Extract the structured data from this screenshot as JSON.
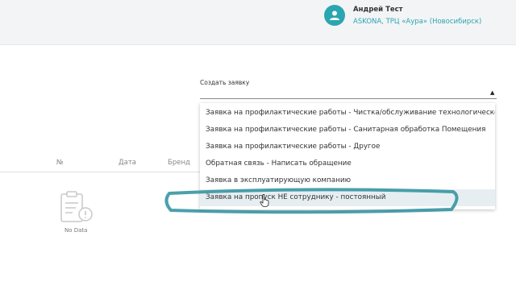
{
  "header": {
    "user_name": "Андрей Тест",
    "user_store": "ASKONA, ТРЦ «Аура» (Новосибирск)",
    "accent_color": "#2aa6b0"
  },
  "create_request": {
    "label": "Создать заявку",
    "options": [
      "Заявка на профилактические работы - Чистка/обслуживание технологического оборудования",
      "Заявка на профилактические работы - Санитарная обработка Помещения",
      "Заявка на профилактические работы - Другое",
      "Обратная связь - Написать обращение",
      "Заявка в эксплуатирующую компанию",
      "Заявка на пропуск НЕ сотруднику - постоянный"
    ],
    "highlighted_index": 5
  },
  "table": {
    "columns": [
      "№",
      "Дата",
      "Бренд"
    ],
    "empty_text": "No Data"
  },
  "icons": {
    "avatar": "user-icon",
    "dropdown_arrow": "caret-up-icon",
    "empty": "clipboard-warning-icon",
    "cursor": "hand-pointer-icon"
  }
}
